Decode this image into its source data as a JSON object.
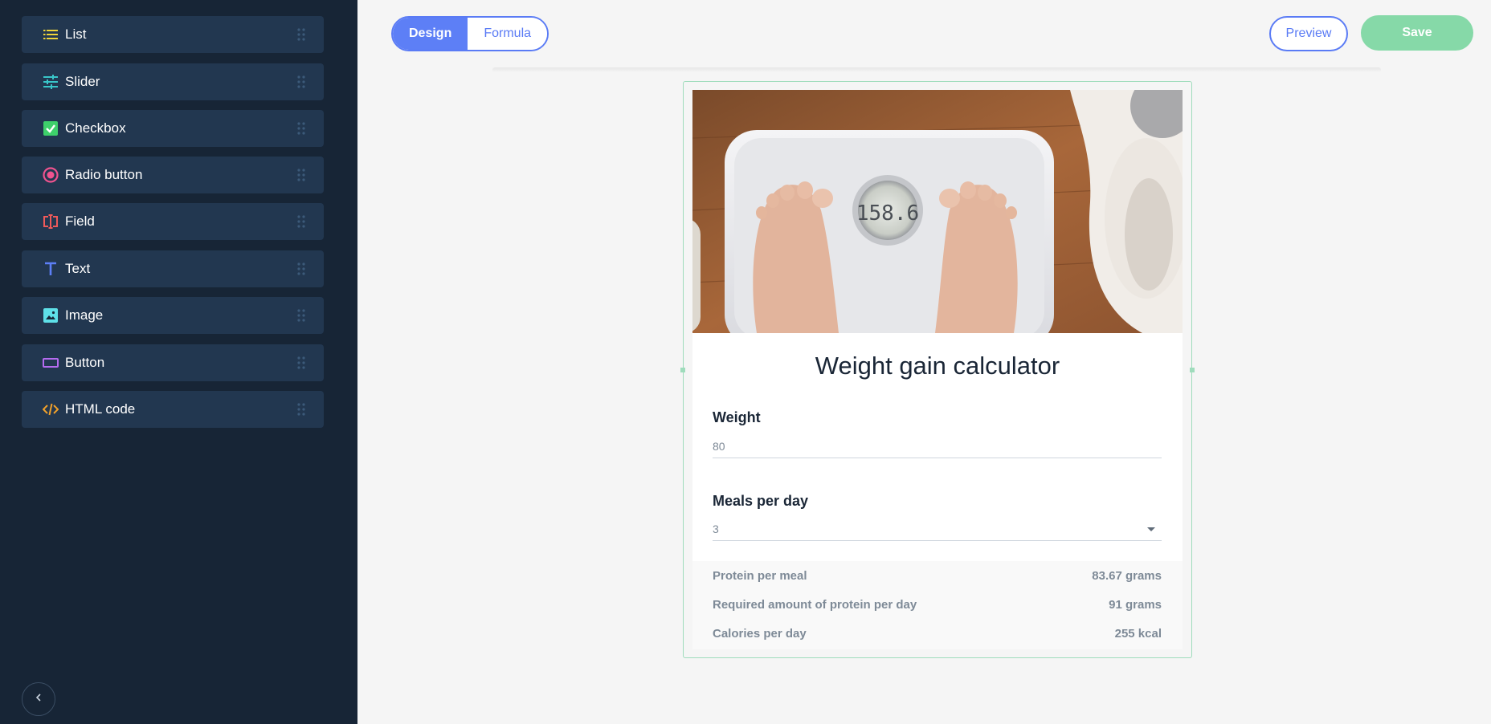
{
  "sidebar": {
    "items": [
      {
        "label": "List",
        "icon": "list-icon"
      },
      {
        "label": "Slider",
        "icon": "slider-icon"
      },
      {
        "label": "Checkbox",
        "icon": "checkbox-icon"
      },
      {
        "label": "Radio button",
        "icon": "radio-button-icon"
      },
      {
        "label": "Field",
        "icon": "field-icon"
      },
      {
        "label": "Text",
        "icon": "text-icon"
      },
      {
        "label": "Image",
        "icon": "image-icon"
      },
      {
        "label": "Button",
        "icon": "button-icon"
      },
      {
        "label": "HTML code",
        "icon": "html-code-icon"
      }
    ]
  },
  "toolbar": {
    "tabs": [
      {
        "label": "Design",
        "active": true
      },
      {
        "label": "Formula",
        "active": false
      }
    ],
    "preview_label": "Preview",
    "save_label": "Save"
  },
  "widget": {
    "title": "Weight gain calculator",
    "scale_display": "158.6",
    "fields": [
      {
        "label": "Weight",
        "value": "80"
      },
      {
        "label": "Meals per day",
        "value": "3"
      }
    ],
    "results": [
      {
        "label": "Protein per meal",
        "value": "83.67 grams"
      },
      {
        "label": "Required amount of protein per day",
        "value": "91 grams"
      },
      {
        "label": "Calories per day",
        "value": "255 kcal"
      }
    ]
  },
  "colors": {
    "sidebar_bg": "#172536",
    "item_bg": "#223750",
    "accent": "#5a7bf5",
    "save": "#86d9a8",
    "selection": "#9fdcbc"
  }
}
